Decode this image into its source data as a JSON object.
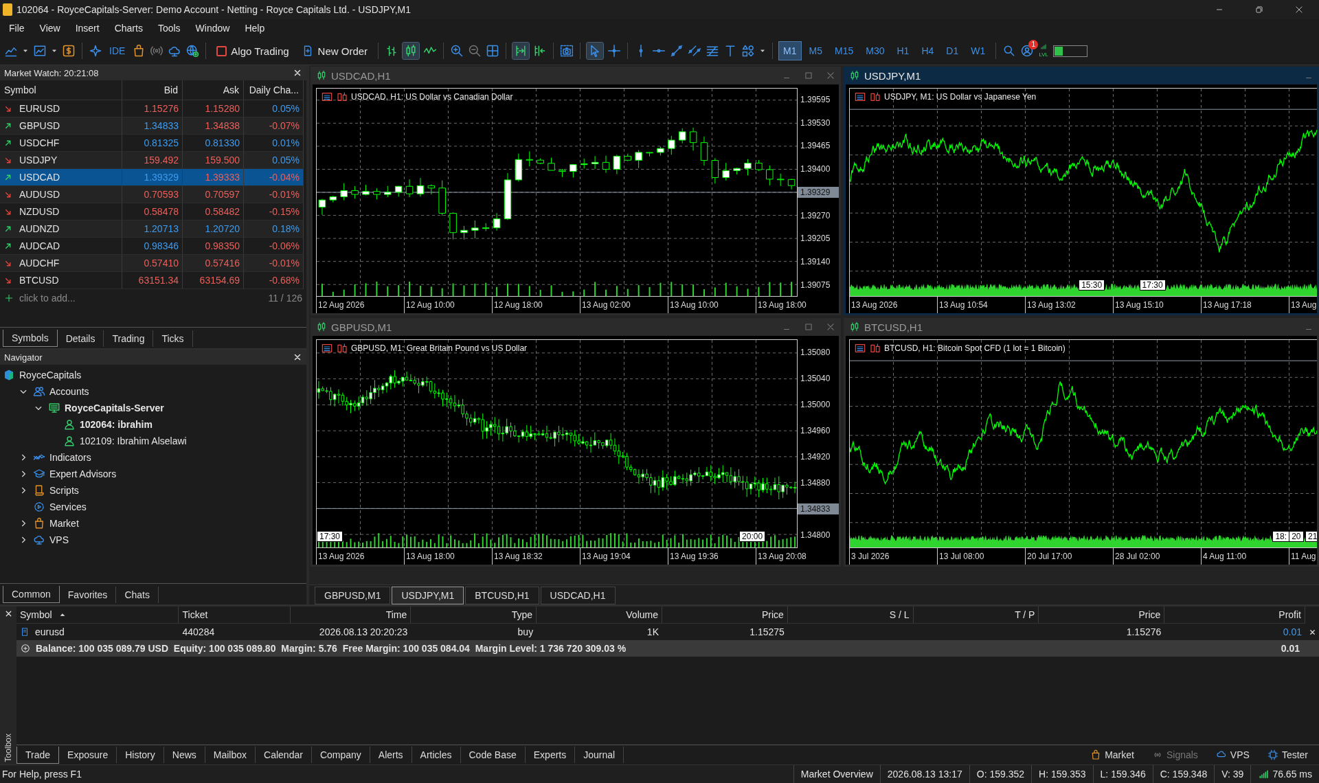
{
  "window": {
    "title": "102064 - RoyceCapitals-Server: Demo Account - Netting - Royce Capitals Ltd. - USDJPY,M1"
  },
  "menu": [
    "File",
    "View",
    "Insert",
    "Charts",
    "Tools",
    "Window",
    "Help"
  ],
  "toolbar": {
    "ide": "IDE",
    "algo_trading": {
      "label": "Algo Trading",
      "on": false
    },
    "new_order": "New Order",
    "timeframes": [
      {
        "label": "M1",
        "selected": true
      },
      {
        "label": "M5",
        "selected": false
      },
      {
        "label": "M15",
        "selected": false
      },
      {
        "label": "M30",
        "selected": false
      },
      {
        "label": "H1",
        "selected": false
      },
      {
        "label": "H4",
        "selected": false
      },
      {
        "label": "D1",
        "selected": false
      },
      {
        "label": "W1",
        "selected": false
      }
    ],
    "notifications": "1",
    "level_label": "LVL",
    "meter": {
      "level": 0.25
    }
  },
  "market_watch": {
    "title": "Market Watch: 20:21:08",
    "columns": [
      "Symbol",
      "Bid",
      "Ask",
      "Daily Cha..."
    ],
    "rows": [
      {
        "symbol": "EURUSD",
        "rising": false,
        "bid": "1.15276",
        "bid_up": false,
        "ask": "1.15280",
        "ask_up": false,
        "change": "0.05%",
        "change_up": true,
        "selected": false
      },
      {
        "symbol": "GBPUSD",
        "rising": true,
        "bid": "1.34833",
        "bid_up": true,
        "ask": "1.34838",
        "ask_up": false,
        "change": "-0.07%",
        "change_up": false,
        "selected": false
      },
      {
        "symbol": "USDCHF",
        "rising": true,
        "bid": "0.81325",
        "bid_up": true,
        "ask": "0.81330",
        "ask_up": true,
        "change": "0.01%",
        "change_up": true,
        "selected": false
      },
      {
        "symbol": "USDJPY",
        "rising": false,
        "bid": "159.492",
        "bid_up": false,
        "ask": "159.500",
        "ask_up": false,
        "change": "0.05%",
        "change_up": true,
        "selected": false
      },
      {
        "symbol": "USDCAD",
        "rising": true,
        "bid": "1.39329",
        "bid_up": true,
        "ask": "1.39333",
        "ask_up": false,
        "change": "-0.04%",
        "change_up": false,
        "selected": true
      },
      {
        "symbol": "AUDUSD",
        "rising": false,
        "bid": "0.70593",
        "bid_up": false,
        "ask": "0.70597",
        "ask_up": false,
        "change": "-0.01%",
        "change_up": false,
        "selected": false
      },
      {
        "symbol": "NZDUSD",
        "rising": false,
        "bid": "0.58478",
        "bid_up": false,
        "ask": "0.58482",
        "ask_up": false,
        "change": "-0.15%",
        "change_up": false,
        "selected": false
      },
      {
        "symbol": "AUDNZD",
        "rising": true,
        "bid": "1.20713",
        "bid_up": true,
        "ask": "1.20720",
        "ask_up": true,
        "change": "0.18%",
        "change_up": true,
        "selected": false
      },
      {
        "symbol": "AUDCAD",
        "rising": true,
        "bid": "0.98346",
        "bid_up": true,
        "ask": "0.98350",
        "ask_up": false,
        "change": "-0.06%",
        "change_up": false,
        "selected": false
      },
      {
        "symbol": "AUDCHF",
        "rising": false,
        "bid": "0.57410",
        "bid_up": false,
        "ask": "0.57416",
        "ask_up": false,
        "change": "-0.01%",
        "change_up": false,
        "selected": false
      },
      {
        "symbol": "BTCUSD",
        "rising": false,
        "bid": "63151.34",
        "bid_up": false,
        "ask": "63154.69",
        "ask_up": false,
        "change": "-0.68%",
        "change_up": false,
        "selected": false
      }
    ],
    "add_placeholder": "click to add...",
    "count": "11 / 126",
    "tabs": [
      {
        "label": "Symbols",
        "selected": true
      },
      {
        "label": "Details",
        "selected": false
      },
      {
        "label": "Trading",
        "selected": false
      },
      {
        "label": "Ticks",
        "selected": false
      }
    ]
  },
  "navigator": {
    "title": "Navigator",
    "tree": {
      "label": "RoyceCapitals",
      "kind": "broker",
      "children": [
        {
          "label": "Accounts",
          "kind": "accounts",
          "expanded": true,
          "children": [
            {
              "label": "RoyceCapitals-Server",
              "kind": "server",
              "expanded": true,
              "active": true,
              "children": [
                {
                  "label": "102064: ibrahim",
                  "kind": "account",
                  "active": true
                },
                {
                  "label": "102109: Ibrahim Alselawi",
                  "kind": "account",
                  "active": false
                }
              ]
            }
          ]
        },
        {
          "label": "Indicators",
          "kind": "indicators",
          "expanded": false
        },
        {
          "label": "Expert Advisors",
          "kind": "experts",
          "expanded": false
        },
        {
          "label": "Scripts",
          "kind": "scripts",
          "expanded": false
        },
        {
          "label": "Services",
          "kind": "services"
        },
        {
          "label": "Market",
          "kind": "market",
          "expanded": false
        },
        {
          "label": "VPS",
          "kind": "vps",
          "expanded": false
        }
      ]
    },
    "tabs": [
      {
        "label": "Common",
        "selected": true
      },
      {
        "label": "Favorites",
        "selected": false
      },
      {
        "label": "Chats",
        "selected": false
      }
    ]
  },
  "charts": [
    {
      "title": "USDCAD,H1",
      "active": false,
      "kind": "candles",
      "legend": "USDCAD, H1:  US Dollar vs Canadian Dollar",
      "closable": true,
      "y_labels": [
        "1.39595",
        "1.39530",
        "1.39465",
        "1.39400",
        "1.39270",
        "1.39205",
        "1.39140",
        "1.39075"
      ],
      "price": "1.39329",
      "x_labels": [
        "12 Aug 2026",
        "12 Aug 10:00",
        "12 Aug 18:00",
        "13 Aug 02:00",
        "13 Aug 10:00",
        "13 Aug 18:00"
      ]
    },
    {
      "title": "USDJPY,M1",
      "active": true,
      "kind": "line",
      "legend": "USDJPY, M1:  US Dollar vs Japanese Yen",
      "closable": false,
      "x_labels": [
        "13 Aug 2026",
        "13 Aug 10:54",
        "13 Aug 13:02",
        "13 Aug 15:10",
        "13 Aug 17:18",
        "13 Aug"
      ],
      "markers": [
        "15:30",
        "17:30"
      ]
    },
    {
      "title": "GBPUSD,M1",
      "active": false,
      "kind": "candles",
      "legend": "GBPUSD, M1:  Great Britain Pound vs US Dollar",
      "closable": true,
      "y_labels": [
        "1.35080",
        "1.35040",
        "1.35000",
        "1.34960",
        "1.34920",
        "1.34880",
        "1.34800"
      ],
      "price": "1.34833",
      "x_labels": [
        "13 Aug 2026",
        "13 Aug 18:00",
        "13 Aug 18:32",
        "13 Aug 19:04",
        "13 Aug 19:36",
        "13 Aug 20:08"
      ],
      "markers": [
        "17:30",
        "20:00"
      ]
    },
    {
      "title": "BTCUSD,H1",
      "active": false,
      "kind": "line",
      "legend": "BTCUSD, H1:  Bitcoin Spot CFD (1 lot = 1 Bitcoin)",
      "closable": false,
      "x_labels": [
        "3 Jul 2026",
        "13 Jul 08:00",
        "20 Jul 17:00",
        "28 Jul 02:00",
        "4 Aug 11:00",
        "11 Aug"
      ],
      "markers": [
        "18:",
        "20",
        "21"
      ]
    }
  ],
  "chart_tabs": [
    {
      "label": "GBPUSD,M1",
      "selected": false
    },
    {
      "label": "USDJPY,M1",
      "selected": true
    },
    {
      "label": "BTCUSD,H1",
      "selected": false
    },
    {
      "label": "USDCAD,H1",
      "selected": false
    }
  ],
  "toolbox": {
    "label": "Toolbox",
    "columns": [
      "Symbol",
      "Ticket",
      "Time",
      "Type",
      "Volume",
      "Price",
      "S / L",
      "T / P",
      "Price",
      "Profit"
    ],
    "rows": [
      {
        "cells": [
          "eurusd",
          "440284",
          "2026.08.13 20:20:23",
          "buy",
          "1K",
          "1.15275",
          "",
          "",
          "1.15276",
          "0.01"
        ]
      }
    ],
    "summary": "Balance: 100 035 089.79 USD  Equity: 100 035 089.80  Margin: 5.76  Free Margin: 100 035 084.04  Margin Level: 1 736 720 309.03 %",
    "summary_total": "0.01",
    "tabs": [
      {
        "label": "Trade",
        "selected": true
      },
      {
        "label": "Exposure",
        "selected": false
      },
      {
        "label": "History",
        "selected": false
      },
      {
        "label": "News",
        "selected": false
      },
      {
        "label": "Mailbox",
        "selected": false
      },
      {
        "label": "Calendar",
        "selected": false
      },
      {
        "label": "Company",
        "selected": false
      },
      {
        "label": "Alerts",
        "selected": false
      },
      {
        "label": "Articles",
        "selected": false
      },
      {
        "label": "Code Base",
        "selected": false
      },
      {
        "label": "Experts",
        "selected": false
      },
      {
        "label": "Journal",
        "selected": false
      }
    ],
    "links": [
      {
        "label": "Market",
        "kind": "market",
        "disabled": false
      },
      {
        "label": "Signals",
        "kind": "signals",
        "disabled": true
      },
      {
        "label": "VPS",
        "kind": "vps",
        "disabled": false
      },
      {
        "label": "Tester",
        "kind": "tester",
        "disabled": false
      }
    ]
  },
  "status_bar": {
    "help": "For Help, press F1",
    "cells": [
      "Market Overview",
      "2026.08.13 13:17",
      "O: 159.352",
      "H: 159.353",
      "L: 159.346",
      "C: 159.348",
      "V: 39"
    ],
    "ping": "76.65 ms"
  }
}
